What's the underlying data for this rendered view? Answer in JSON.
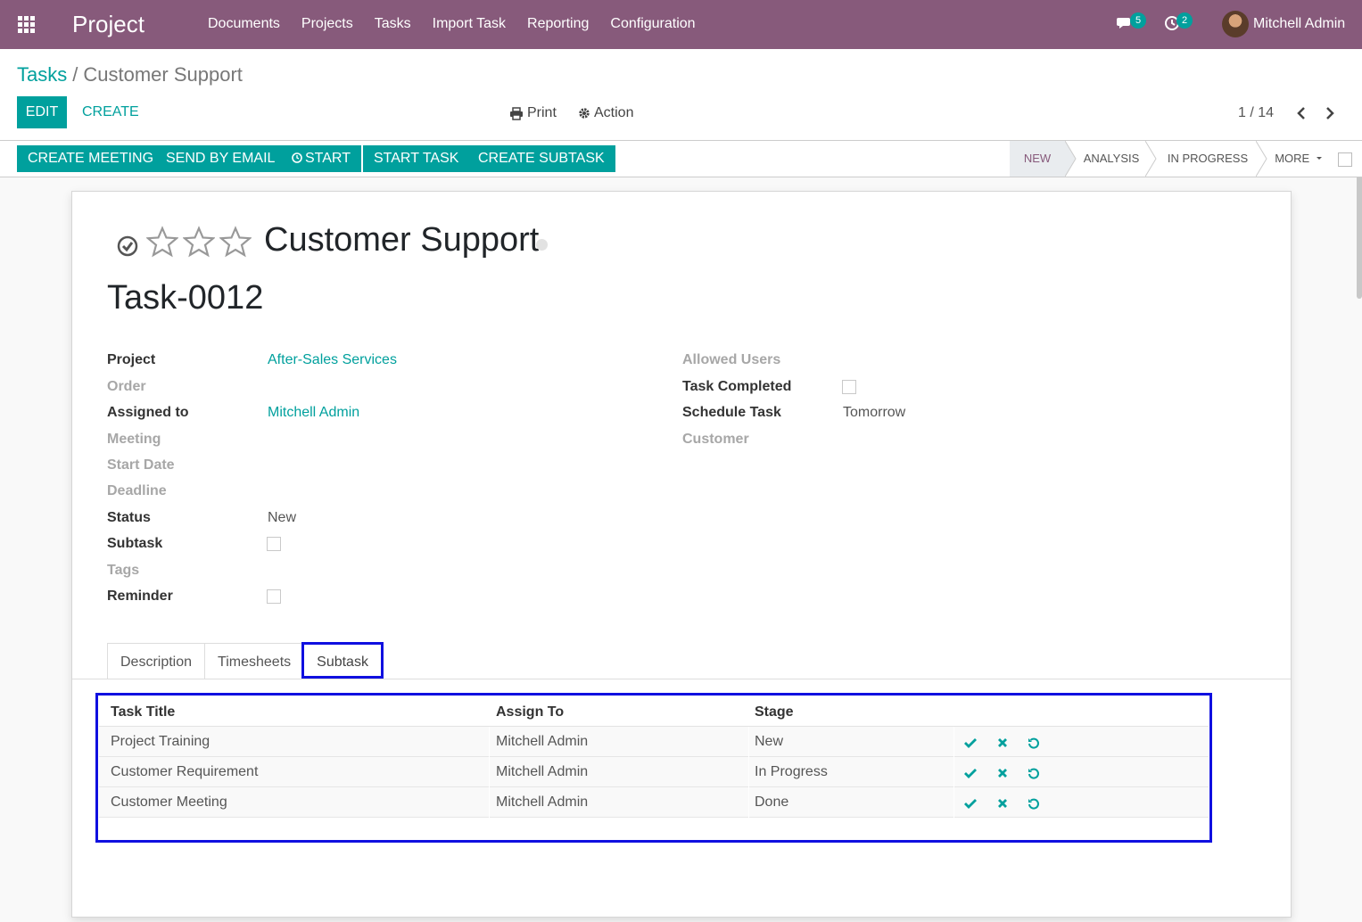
{
  "navbar": {
    "app_title": "Project",
    "menu": [
      "Documents",
      "Projects",
      "Tasks",
      "Import Task",
      "Reporting",
      "Configuration"
    ],
    "messages_count": "5",
    "activities_count": "2",
    "user_name": "Mitchell Admin",
    "bg_color": "#875a7b"
  },
  "breadcrumb": {
    "parent": "Tasks",
    "separator": "/",
    "current": "Customer Support"
  },
  "control": {
    "edit_label": "EDIT",
    "create_label": "CREATE",
    "print_label": "Print",
    "action_label": "Action",
    "pager": "1 / 14"
  },
  "statusbar": {
    "buttons": [
      "CREATE MEETING",
      "SEND BY EMAIL",
      "START",
      "START TASK",
      "CREATE SUBTASK"
    ],
    "stages": [
      "NEW",
      "ANALYSIS",
      "IN PROGRESS",
      "MORE"
    ],
    "active_stage": "NEW"
  },
  "task": {
    "name": "Customer Support",
    "code": "Task-0012",
    "priority_stars": 3,
    "priority_selected": 0
  },
  "fields_left": [
    {
      "label": "Project",
      "value": "After-Sales Services",
      "type": "link",
      "required": true
    },
    {
      "label": "Order",
      "value": "",
      "type": "text",
      "required": false
    },
    {
      "label": "Assigned to",
      "value": "Mitchell Admin",
      "type": "link",
      "required": true
    },
    {
      "label": "Meeting",
      "value": "",
      "type": "text",
      "required": false
    },
    {
      "label": "Start Date",
      "value": "",
      "type": "text",
      "required": false
    },
    {
      "label": "Deadline",
      "value": "",
      "type": "text",
      "required": false
    },
    {
      "label": "Status",
      "value": "New",
      "type": "text",
      "required": true
    },
    {
      "label": "Subtask",
      "value": "",
      "type": "checkbox",
      "required": true
    },
    {
      "label": "Tags",
      "value": "",
      "type": "text",
      "required": false
    },
    {
      "label": "Reminder",
      "value": "",
      "type": "checkbox",
      "required": true
    }
  ],
  "fields_right": [
    {
      "label": "Allowed Users",
      "value": "",
      "type": "text",
      "required": false
    },
    {
      "label": "Task Completed",
      "value": "",
      "type": "checkbox",
      "required": true
    },
    {
      "label": "Schedule Task",
      "value": "Tomorrow",
      "type": "text",
      "required": true
    },
    {
      "label": "Customer",
      "value": "",
      "type": "text",
      "required": false
    }
  ],
  "tabs": [
    "Description",
    "Timesheets",
    "Subtask"
  ],
  "active_tab": "Subtask",
  "subtasks": {
    "headers": [
      "Task Title",
      "Assign To",
      "Stage"
    ],
    "rows": [
      {
        "title": "Project Training",
        "assignee": "Mitchell Admin",
        "stage": "New"
      },
      {
        "title": "Customer Requirement",
        "assignee": "Mitchell Admin",
        "stage": "In Progress"
      },
      {
        "title": "Customer Meeting",
        "assignee": "Mitchell Admin",
        "stage": "Done"
      }
    ],
    "row_actions": [
      "check-icon",
      "cross-icon",
      "undo-icon"
    ]
  },
  "colors": {
    "accent": "#00a09d",
    "highlight": "#1010e0"
  }
}
